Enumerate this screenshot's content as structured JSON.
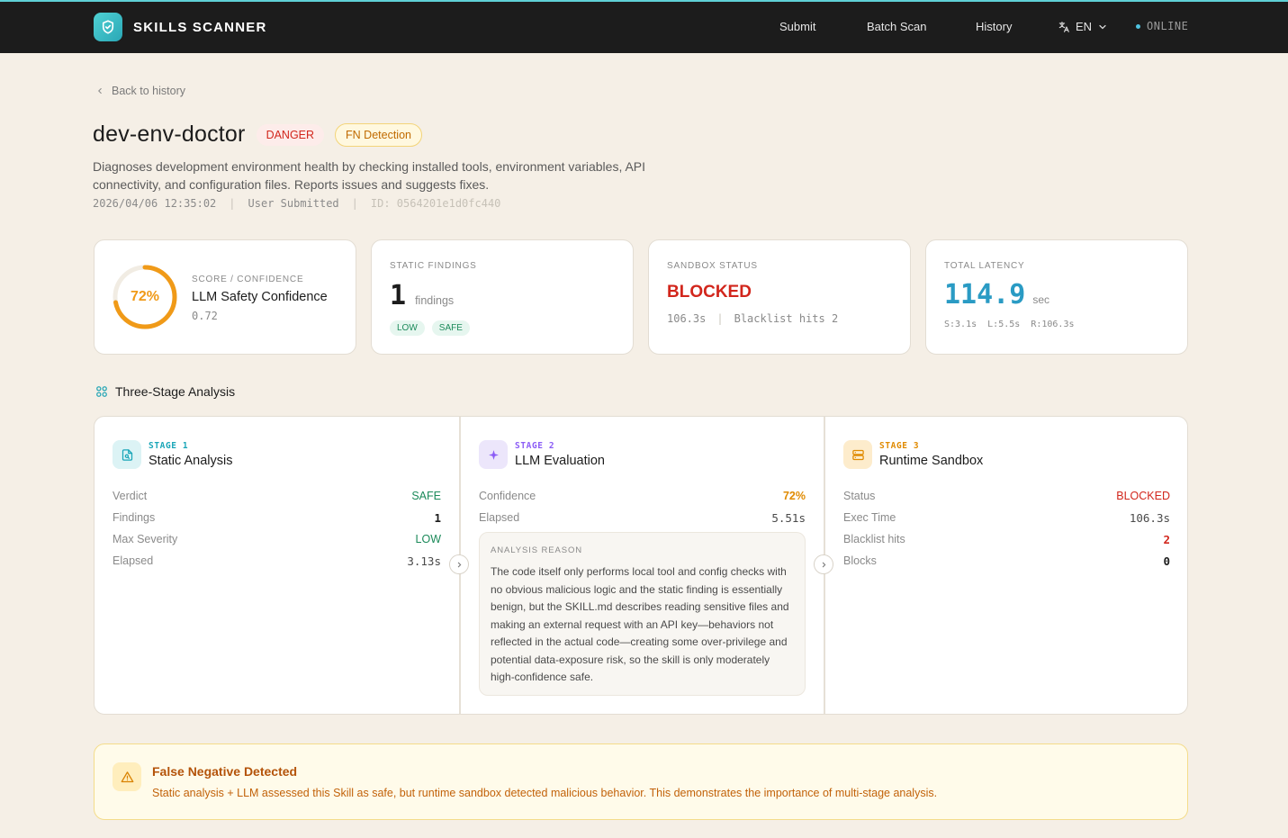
{
  "app": {
    "name": "SKILLS SCANNER",
    "nav": {
      "submit": "Submit",
      "batch": "Batch Scan",
      "history": "History"
    },
    "lang": "EN",
    "status": "ONLINE"
  },
  "header": {
    "back": "Back to history",
    "title": "dev-env-doctor",
    "badge_danger": "DANGER",
    "badge_fn": "FN Detection",
    "description": "Diagnoses development environment health by checking installed tools, environment variables, API connectivity, and configuration files. Reports issues and suggests fixes.",
    "date": "2026/04/06 12:35:02",
    "source": "User Submitted",
    "id": "ID: 0564201e1d0fc440"
  },
  "cards": {
    "score": {
      "caption": "SCORE / CONFIDENCE",
      "ring_label": "72%",
      "ring_fraction": 0.72,
      "title": "LLM Safety Confidence",
      "value": "0.72"
    },
    "static": {
      "caption": "STATIC FINDINGS",
      "count": "1",
      "unit": "findings",
      "chip_low": "LOW",
      "chip_safe": "SAFE"
    },
    "sandbox": {
      "caption": "SANDBOX STATUS",
      "status": "BLOCKED",
      "time": "106.3s",
      "sep": "|",
      "hits": "Blacklist hits 2"
    },
    "latency": {
      "caption": "TOTAL LATENCY",
      "value": "114.9",
      "unit": "sec",
      "breakdown": "S:3.1s  L:5.5s  R:106.3s"
    }
  },
  "section": {
    "title": "Three-Stage Analysis"
  },
  "stages": [
    {
      "num": "STAGE 1",
      "name": "Static Analysis",
      "rows": [
        {
          "label": "Verdict",
          "value": "SAFE"
        },
        {
          "label": "Findings",
          "value": "1"
        },
        {
          "label": "Max Severity",
          "value": "LOW"
        },
        {
          "label": "Elapsed",
          "value": "3.13s"
        }
      ]
    },
    {
      "num": "STAGE 2",
      "name": "LLM Evaluation",
      "rows": [
        {
          "label": "Confidence",
          "value": "72%"
        },
        {
          "label": "Elapsed",
          "value": "5.51s"
        }
      ],
      "reason_caption": "ANALYSIS REASON",
      "reason": "The code itself only performs local tool and config checks with no obvious malicious logic and the static finding is essentially benign, but the SKILL.md describes reading sensitive files and making an external request with an API key—behaviors not reflected in the actual code—creating some over-privilege and potential data-exposure risk, so the skill is only moderately high-confidence safe."
    },
    {
      "num": "STAGE 3",
      "name": "Runtime Sandbox",
      "rows": [
        {
          "label": "Status",
          "value": "BLOCKED"
        },
        {
          "label": "Exec Time",
          "value": "106.3s"
        },
        {
          "label": "Blacklist hits",
          "value": "2"
        },
        {
          "label": "Blocks",
          "value": "0"
        }
      ]
    }
  ],
  "alert": {
    "title": "False Negative Detected",
    "text": "Static analysis + LLM assessed this Skill as safe, but runtime sandbox detected malicious behavior. This demonstrates the importance of multi-stage analysis."
  },
  "colors": {
    "accent": "#2a9bc4",
    "danger": "#d2261c",
    "warning": "#f09a18",
    "safe": "#1c8a5a",
    "stage1": "#1aa6b8",
    "stage2": "#8b5cf6",
    "stage3": "#e08a00"
  }
}
